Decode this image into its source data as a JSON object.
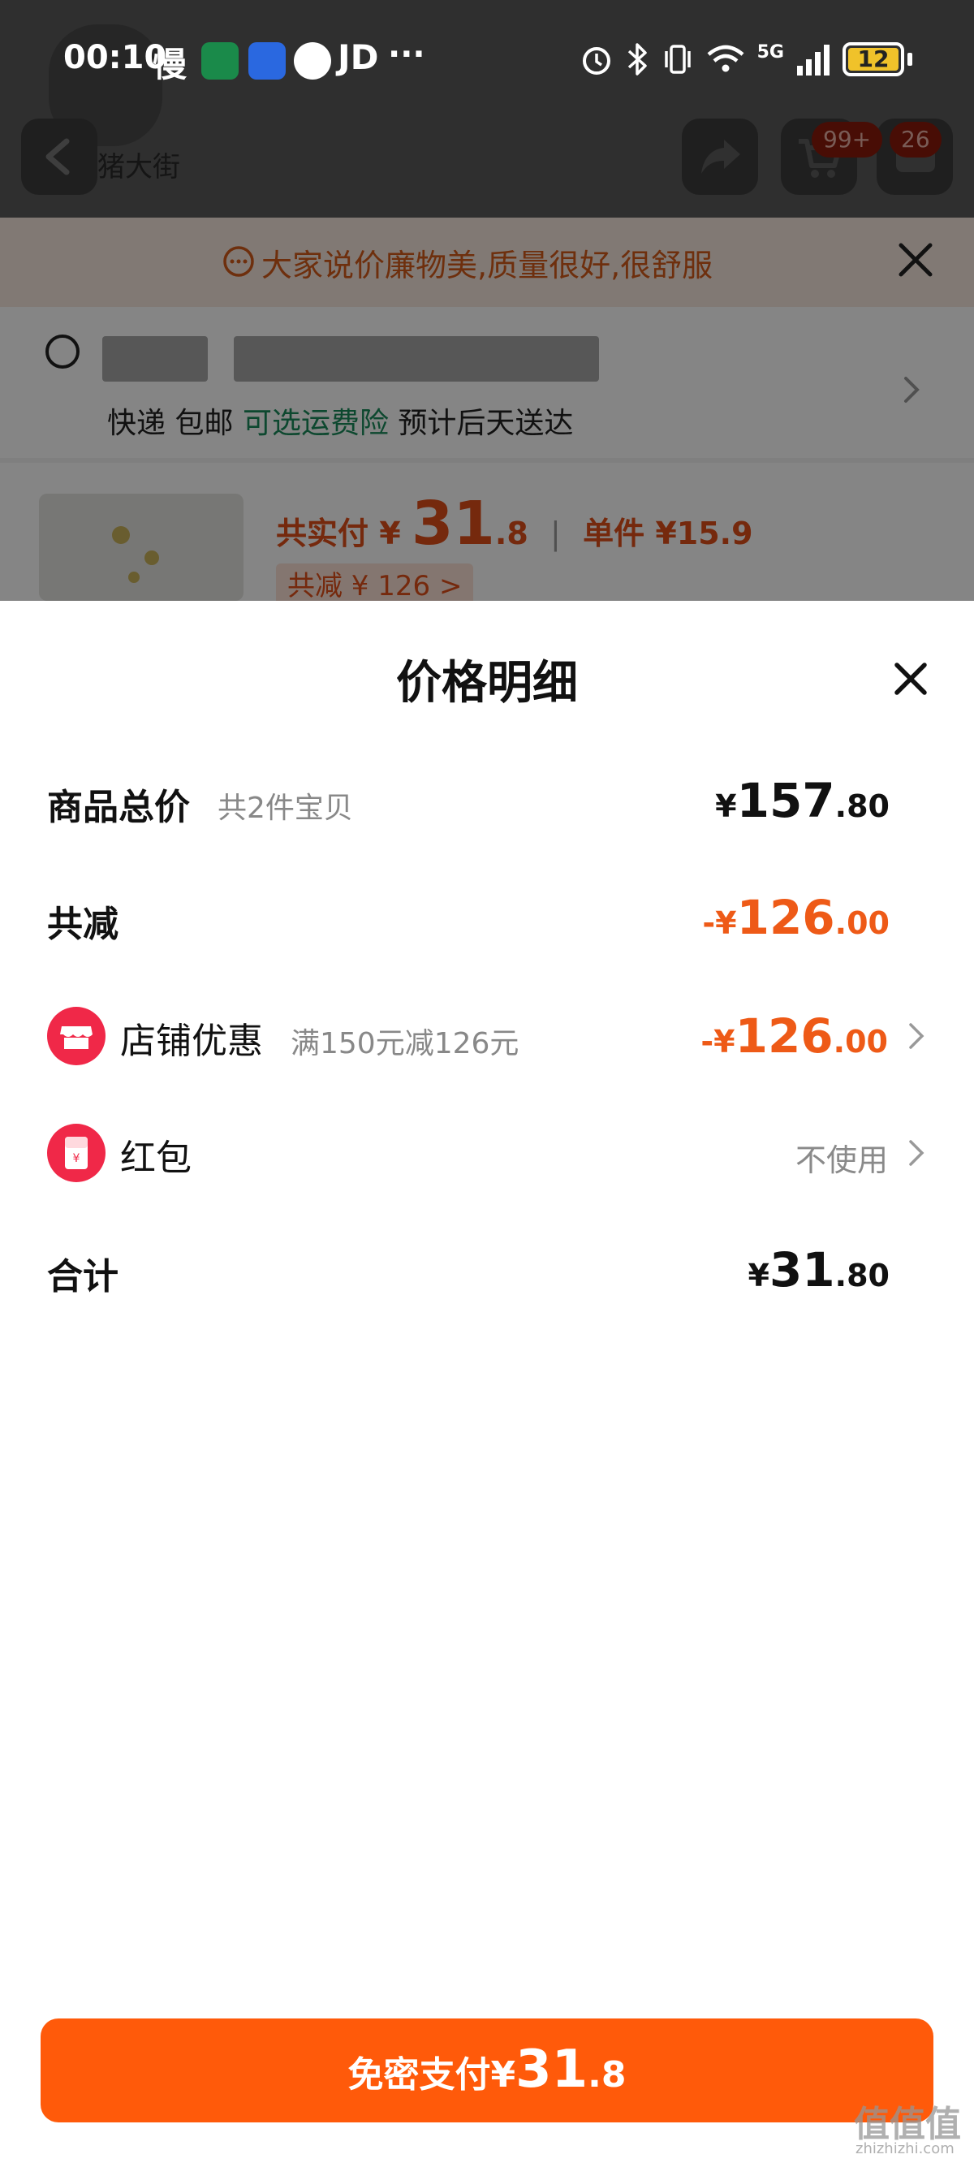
{
  "status_bar": {
    "time": "00:10",
    "slow_label": "慢",
    "app_label": "JD",
    "more": "···",
    "network": "5G",
    "battery": "12"
  },
  "background": {
    "logo_text": "猪大街",
    "cart_badge": "99+",
    "msg_badge": "26",
    "notice": "大家说价廉物美,质量很好,很舒服",
    "shipping": {
      "express": "快递",
      "free": "包邮",
      "insurance": "可选运费险",
      "eta": "预计后天送达"
    },
    "product": {
      "pay_label": "共实付",
      "currency": "¥",
      "pay_int": "31",
      "pay_dec": ".8",
      "unit_label": "单件",
      "unit_price": "¥15.9",
      "discount": "共减 ¥ 126 >"
    }
  },
  "sheet": {
    "title": "价格明细",
    "rows": {
      "subtotal": {
        "label": "商品总价",
        "sub": "共2件宝贝",
        "yen": "¥",
        "int": "157",
        "dec": ".80"
      },
      "discount": {
        "label": "共减",
        "yen": "-¥",
        "int": "126",
        "dec": ".00"
      },
      "store": {
        "label": "店铺优惠",
        "sub": "满150元减126元",
        "yen": "-¥",
        "int": "126",
        "dec": ".00"
      },
      "redpacket": {
        "label": "红包",
        "value": "不使用"
      },
      "total": {
        "label": "合计",
        "yen": "¥",
        "int": "31",
        "dec": ".80"
      }
    },
    "pay_button": {
      "label": "免密支付",
      "yen": "¥",
      "int": "31",
      "dec": ".8"
    }
  },
  "watermark": {
    "text": "值值值",
    "sub": "zhizhizhi.com"
  },
  "colors": {
    "accent": "#ff5a0a",
    "discount": "#ee5a17",
    "store_icon": "#f02848"
  }
}
